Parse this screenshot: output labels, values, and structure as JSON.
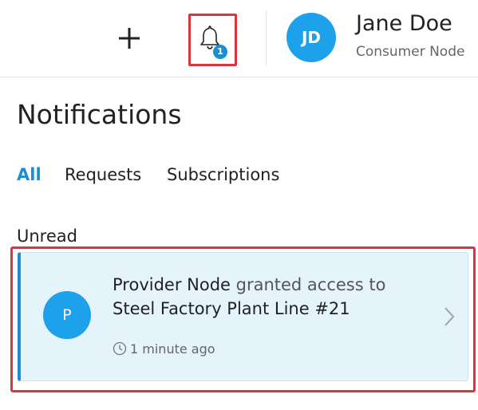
{
  "header": {
    "add_icon": "plus-icon",
    "bell_icon": "bell-icon",
    "notification_count": "1",
    "user": {
      "initials": "JD",
      "name": "Jane Doe",
      "role": "Consumer Node"
    }
  },
  "page": {
    "title": "Notifications"
  },
  "tabs": [
    {
      "label": "All",
      "active": true
    },
    {
      "label": "Requests",
      "active": false
    },
    {
      "label": "Subscriptions",
      "active": false
    }
  ],
  "section": {
    "label": "Unread"
  },
  "notification": {
    "avatar_initial": "P",
    "sender": "Provider Node",
    "action": " granted access to",
    "target": "Steel Factory Plant Line #21",
    "time": "1 minute ago",
    "clock_icon": "clock-icon",
    "chevron_icon": "chevron-right-icon"
  },
  "colors": {
    "accent": "#1a8fd1",
    "avatar": "#1da1ea",
    "card_background": "#e5f3fb",
    "highlight_border": "#d9363e"
  }
}
